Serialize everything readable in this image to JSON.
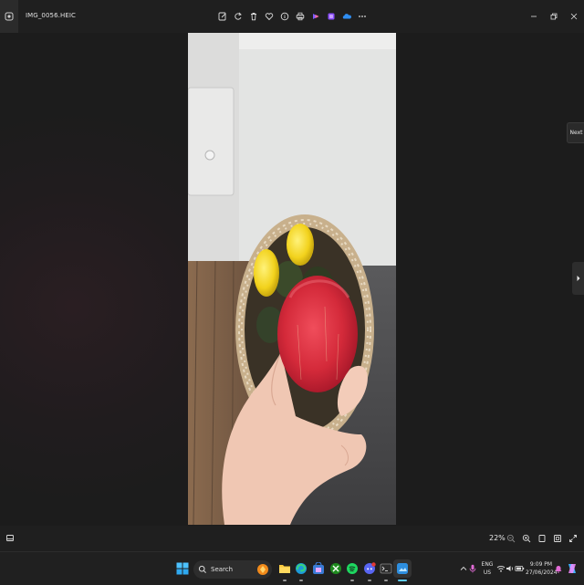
{
  "window": {
    "filename": "IMG_0056.HEIC",
    "controls": [
      "minimize-icon",
      "restore-icon",
      "close-icon"
    ]
  },
  "toolbar": {
    "icons": [
      "edit-icon",
      "rotate-icon",
      "delete-icon",
      "favorite-heart-icon",
      "info-icon",
      "print-icon",
      "clipchamp-icon",
      "designer-icon",
      "onedrive-icon",
      "more-icon"
    ]
  },
  "viewer": {
    "next_tooltip": "Next"
  },
  "statusbar": {
    "zoom": "22%",
    "icons": [
      "filmstrip-icon",
      "zoom-out-icon",
      "zoom-in-icon",
      "actual-size-icon",
      "fit-window-icon",
      "fullscreen-icon"
    ]
  },
  "taskbar": {
    "search_label": "Search",
    "apps": [
      "start-icon",
      "search-icon",
      "copilot-highlight-icon",
      "file-explorer-icon",
      "edge-icon",
      "store-icon",
      "xbox-icon",
      "spotify-icon",
      "discord-icon",
      "terminal-icon",
      "photos-icon"
    ],
    "tray": {
      "lang_line1": "ENG",
      "lang_line2": "US",
      "time": "9:09 PM",
      "date": "27/06/2024"
    }
  },
  "colors": {
    "accent": "#60cdff",
    "apple_red": "#d42a3a",
    "lemon": "#f2d21c"
  }
}
